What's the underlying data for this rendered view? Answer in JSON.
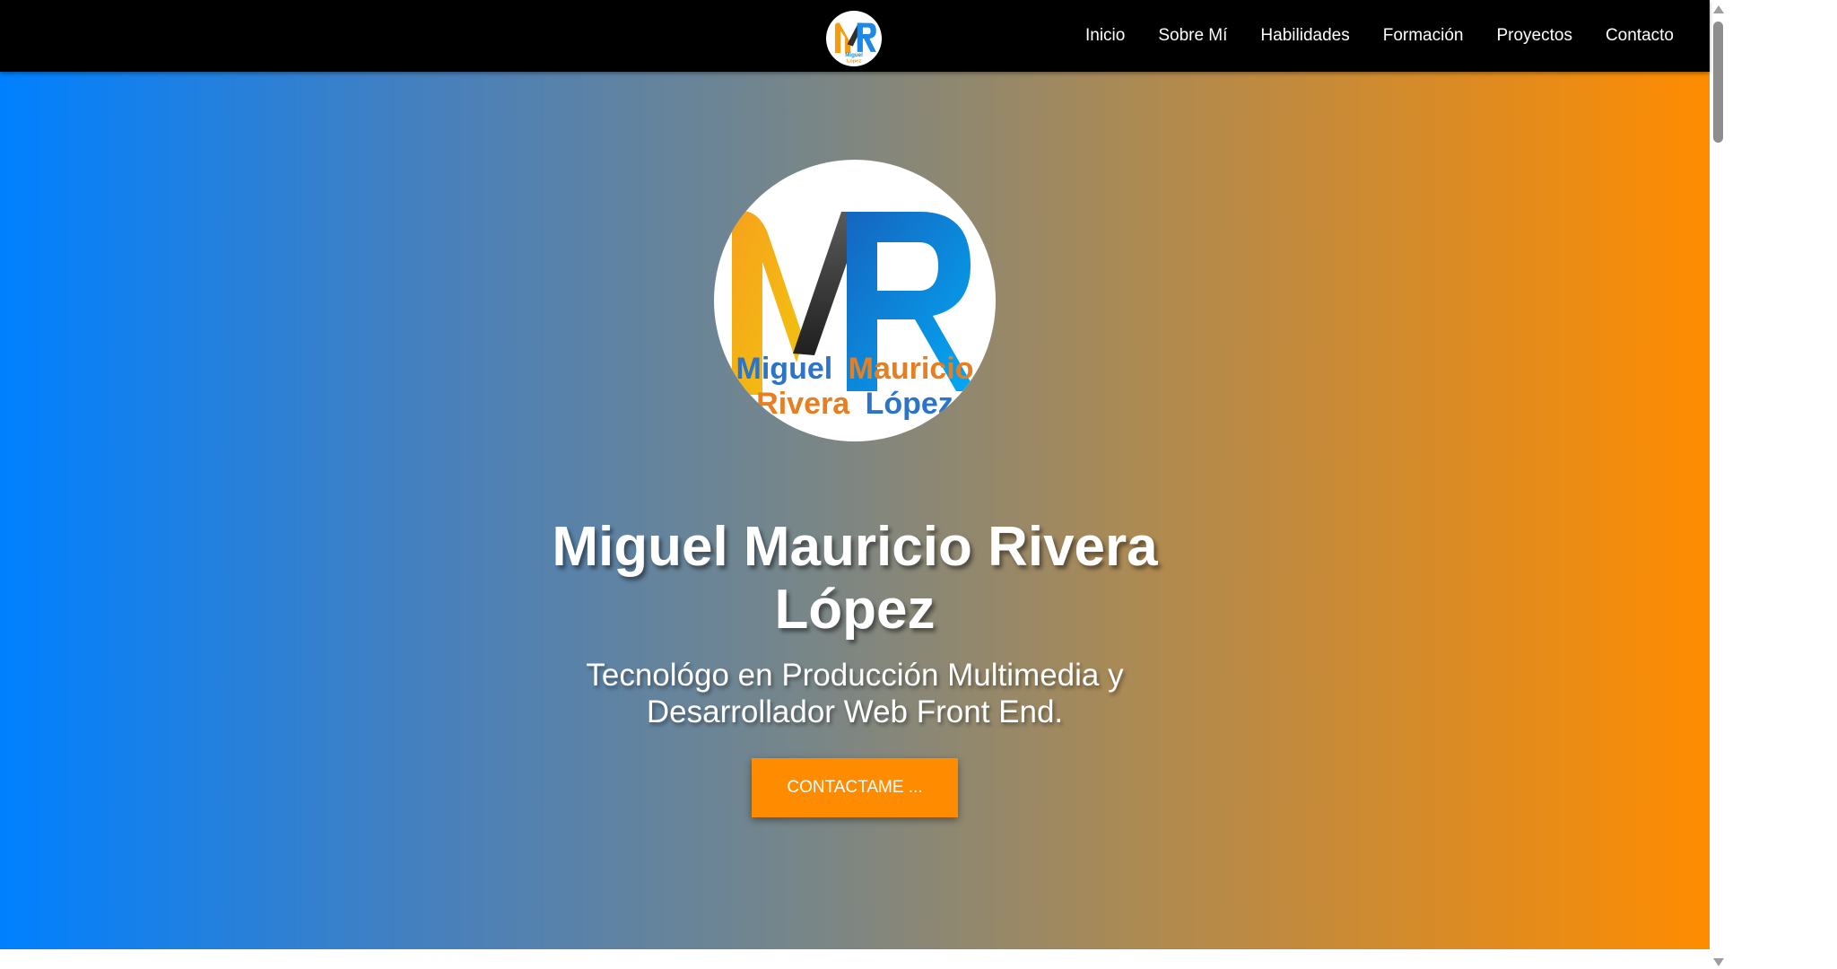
{
  "nav": {
    "logo_icon": "mr-monogram-logo",
    "items": [
      {
        "label": "Inicio"
      },
      {
        "label": "Sobre Mí"
      },
      {
        "label": "Habilidades"
      },
      {
        "label": "Formación"
      },
      {
        "label": "Proyectos"
      },
      {
        "label": "Contacto"
      }
    ]
  },
  "hero": {
    "logo": {
      "monogram": "MR",
      "line1_first": "Miguel",
      "line1_second": "Mauricio",
      "line2_first": "Rivera",
      "line2_second": "López"
    },
    "name_line1": "Miguel Mauricio Rivera",
    "name_line2": "López",
    "subtitle_line1": "Tecnológo en Producción Multimedia y",
    "subtitle_line2": "Desarrollador Web Front End.",
    "button_label": "CONTACTAME ..."
  },
  "colors": {
    "navbar": "#000000",
    "gradient_start": "#0080ff",
    "gradient_end": "#ff8c00",
    "accent": "#ff8c00",
    "logo_blue": "#1e88e5",
    "logo_orange": "#f39c12",
    "logo_dark": "#2f2f2f"
  }
}
